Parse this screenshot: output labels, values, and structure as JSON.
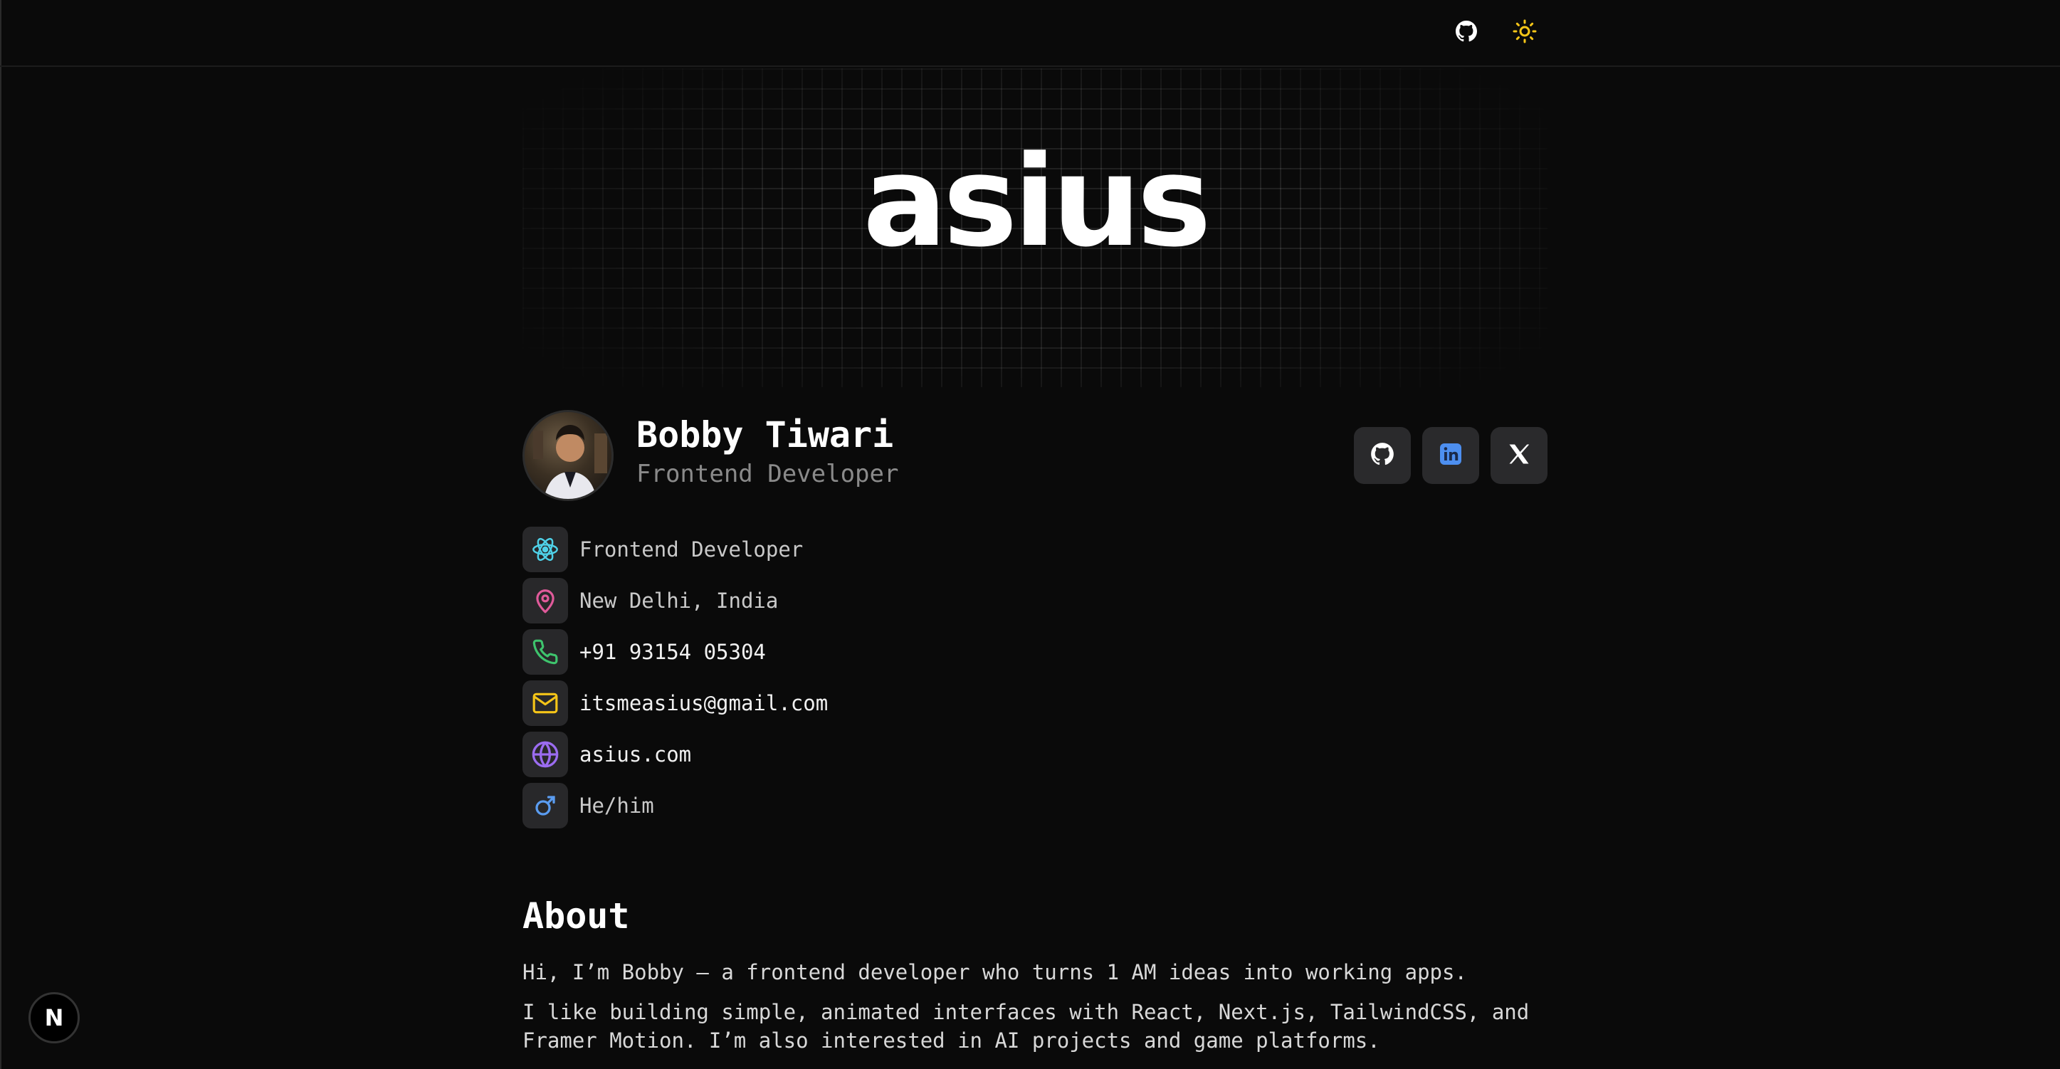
{
  "brand": {
    "logo_text": "asius"
  },
  "topbar": {
    "github_icon": "github-icon",
    "theme_icon": "sun-icon",
    "theme_color": "#f5c518"
  },
  "profile": {
    "name": "Bobby Tiwari",
    "role": "Frontend Developer",
    "socials": [
      {
        "icon": "github-icon"
      },
      {
        "icon": "linkedin-icon",
        "color": "#4d8ff0"
      },
      {
        "icon": "x-icon"
      }
    ]
  },
  "info": [
    {
      "icon": "react-icon",
      "color": "#4fd1e8",
      "text": "Frontend Developer"
    },
    {
      "icon": "map-pin-icon",
      "color": "#e05a9a",
      "text": "New Delhi, India"
    },
    {
      "icon": "phone-icon",
      "color": "#3ec46d",
      "text": "+91 93154 05304"
    },
    {
      "icon": "mail-icon",
      "color": "#f5c518",
      "text": "itsmeasius@gmail.com"
    },
    {
      "icon": "globe-icon",
      "color": "#9b6cf0",
      "text": "asius.com"
    },
    {
      "icon": "male-symbol-icon",
      "color": "#5a9cf0",
      "text": "He/him"
    }
  ],
  "about": {
    "title": "About",
    "paragraphs": [
      "Hi, I’m Bobby — a frontend developer who turns 1 AM ideas into working apps.",
      "I like building simple, animated interfaces with React, Next.js, TailwindCSS, and Framer Motion. I’m also interested in AI projects and game platforms."
    ]
  },
  "badge": {
    "label": "N"
  }
}
